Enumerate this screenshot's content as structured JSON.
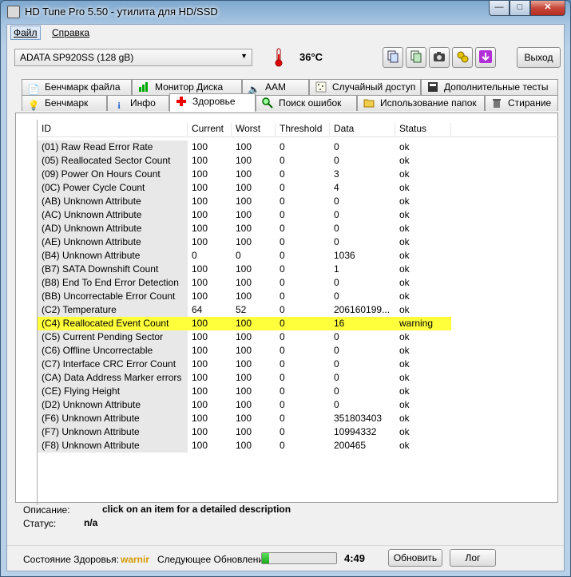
{
  "window": {
    "title": "HD Tune Pro 5.50 - утилита для HD/SSD"
  },
  "menu": {
    "file": "Файл",
    "help": "Справка"
  },
  "toolbar": {
    "drive": "ADATA SP920SS (128 gB)",
    "temperature": "36°C",
    "exit_label": "Выход",
    "icons": [
      "copy-text-icon",
      "copy-info-icon",
      "screenshot-camera-icon",
      "options-icon",
      "save-download-icon"
    ]
  },
  "tabs": {
    "top": [
      "Бенчмарк файла",
      "Монитор Диска",
      "AAM",
      "Случайный доступ",
      "Дополнительные тесты"
    ],
    "bottom": [
      "Бенчмарк",
      "Инфо",
      "Здоровье",
      "Поиск ошибок",
      "Использование папок",
      "Стирание"
    ]
  },
  "table": {
    "columns": [
      "ID",
      "Current",
      "Worst",
      "Threshold",
      "Data",
      "Status"
    ],
    "rows": [
      [
        "(01) Raw Read Error Rate",
        "100",
        "100",
        "0",
        "0",
        "ok"
      ],
      [
        "(05) Reallocated Sector Count",
        "100",
        "100",
        "0",
        "0",
        "ok"
      ],
      [
        "(09) Power On Hours Count",
        "100",
        "100",
        "0",
        "3",
        "ok"
      ],
      [
        "(0C) Power Cycle Count",
        "100",
        "100",
        "0",
        "4",
        "ok"
      ],
      [
        "(AB) Unknown Attribute",
        "100",
        "100",
        "0",
        "0",
        "ok"
      ],
      [
        "(AC) Unknown Attribute",
        "100",
        "100",
        "0",
        "0",
        "ok"
      ],
      [
        "(AD) Unknown Attribute",
        "100",
        "100",
        "0",
        "0",
        "ok"
      ],
      [
        "(AE) Unknown Attribute",
        "100",
        "100",
        "0",
        "0",
        "ok"
      ],
      [
        "(B4) Unknown Attribute",
        "0",
        "0",
        "0",
        "1036",
        "ok"
      ],
      [
        "(B7) SATA Downshift Count",
        "100",
        "100",
        "0",
        "1",
        "ok"
      ],
      [
        "(B8) End To End Error Detection",
        "100",
        "100",
        "0",
        "0",
        "ok"
      ],
      [
        "(BB) Uncorrectable Error Count",
        "100",
        "100",
        "0",
        "0",
        "ok"
      ],
      [
        "(C2) Temperature",
        "64",
        "52",
        "0",
        "206160199...",
        "ok"
      ],
      [
        "(C4) Reallocated Event Count",
        "100",
        "100",
        "0",
        "16",
        "warning"
      ],
      [
        "(C5) Current Pending Sector",
        "100",
        "100",
        "0",
        "0",
        "ok"
      ],
      [
        "(C6) Offline Uncorrectable",
        "100",
        "100",
        "0",
        "0",
        "ok"
      ],
      [
        "(C7) Interface CRC Error Count",
        "100",
        "100",
        "0",
        "0",
        "ok"
      ],
      [
        "(CA) Data Address Marker errors",
        "100",
        "100",
        "0",
        "0",
        "ok"
      ],
      [
        "(CE) Flying Height",
        "100",
        "100",
        "0",
        "0",
        "ok"
      ],
      [
        "(D2) Unknown Attribute",
        "100",
        "100",
        "0",
        "0",
        "ok"
      ],
      [
        "(F6) Unknown Attribute",
        "100",
        "100",
        "0",
        "351803403",
        "ok"
      ],
      [
        "(F7) Unknown Attribute",
        "100",
        "100",
        "0",
        "10994332",
        "ok"
      ],
      [
        "(F8) Unknown Attribute",
        "100",
        "100",
        "0",
        "200465",
        "ok"
      ]
    ]
  },
  "info": {
    "description_label": "Описание:",
    "description_value": "click on an item for a detailed description",
    "status_label": "Статус:",
    "status_value": "n/a"
  },
  "statusbar": {
    "health_label": "Состояние Здоровья:",
    "health_value": "warnir",
    "next_update_label": "Следующее Обновление:",
    "progress": 0.1,
    "countdown": "4:49",
    "refresh_label": "Обновить",
    "log_label": "Лог"
  },
  "colors": {
    "warning_row": "#ffff3c",
    "health_warning": "#d49a00"
  }
}
